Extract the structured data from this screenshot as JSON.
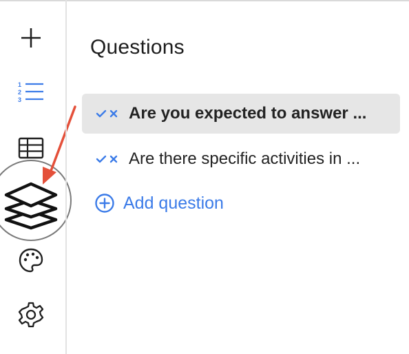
{
  "sidebar": {
    "items": [
      {
        "name": "add",
        "icon": "plus-icon"
      },
      {
        "name": "questions",
        "icon": "numbered-list-icon",
        "active": true
      },
      {
        "name": "table",
        "icon": "table-icon"
      },
      {
        "name": "layers",
        "icon": "layers-icon",
        "highlighted": true
      },
      {
        "name": "theme",
        "icon": "palette-icon"
      },
      {
        "name": "settings",
        "icon": "gear-icon"
      }
    ]
  },
  "main": {
    "title": "Questions",
    "questions": [
      {
        "label": "Are you expected to answer ...",
        "active": true
      },
      {
        "label": "Are there specific activities in ...",
        "active": false
      }
    ],
    "add_label": "Add question"
  },
  "colors": {
    "accent": "#3b7be8",
    "arrow": "#e4503a",
    "active_bg": "#e6e6e6"
  }
}
